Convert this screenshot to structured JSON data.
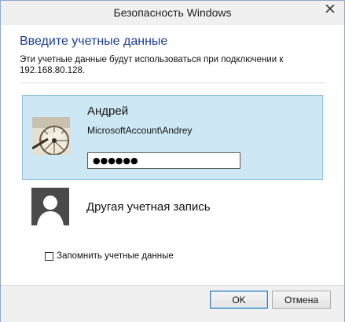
{
  "window": {
    "title": "Безопасность Windows"
  },
  "dialog": {
    "heading": "Введите учетные данные",
    "description": "Эти учетные данные будут использоваться при подключении к 192.168.80.128."
  },
  "selected_user": {
    "name": "Андрей",
    "account": "MicrosoftAccount\\Andrey",
    "password_masked": "●●●●●●"
  },
  "other_account": {
    "label": "Другая учетная запись"
  },
  "remember": {
    "label": "Запомнить учетные данные",
    "checked": false
  },
  "buttons": {
    "ok": "OK",
    "cancel": "Отмена"
  },
  "icons": {
    "close": "close-icon",
    "user_photo": "user-photo",
    "generic_user": "user-silhouette-icon"
  },
  "colors": {
    "heading": "#1a3d96",
    "selection": "#cde8f4",
    "selection_border": "#8fc4de"
  }
}
